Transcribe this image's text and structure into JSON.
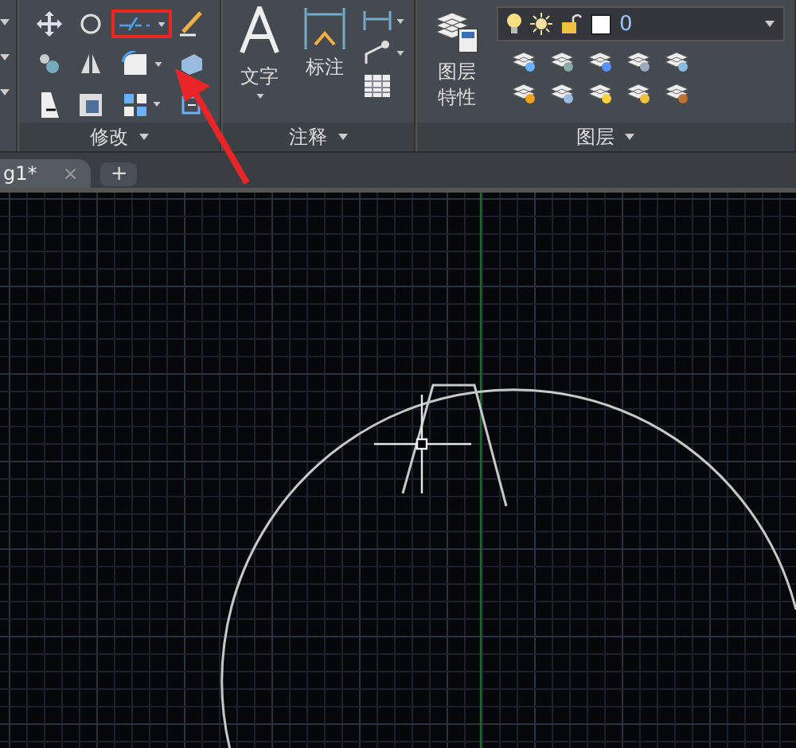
{
  "ribbon": {
    "panels": [
      {
        "kind": "modify",
        "title": "修改"
      },
      {
        "kind": "annotate",
        "title": "注释",
        "buttons": [
          "文字",
          "标注"
        ]
      },
      {
        "kind": "layers",
        "title": "图层",
        "button_lines": [
          "图层",
          "特性"
        ],
        "layer_value": "0"
      }
    ]
  },
  "file_tabs": [
    {
      "label": "g1*",
      "close": "×",
      "selected": true
    }
  ],
  "new_tab": "+"
}
